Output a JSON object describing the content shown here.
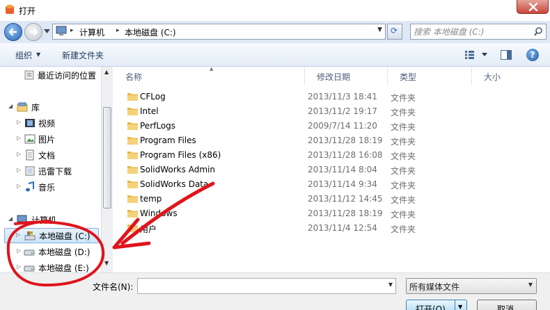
{
  "window": {
    "title": "打开",
    "close_icon": "close-icon"
  },
  "navbar": {
    "breadcrumbs": [
      "计算机",
      "本地磁盘 (C:)"
    ],
    "search_placeholder": "搜索 本地磁盘 (C:)"
  },
  "toolbar": {
    "organize_label": "组织",
    "new_folder_label": "新建文件夹",
    "help_label": "?"
  },
  "navpane": {
    "items": [
      {
        "label": "最近访问的位置",
        "icon": "recent-places-icon"
      },
      {
        "label": "库",
        "icon": "library-icon"
      },
      {
        "label": "视频",
        "icon": "video-icon"
      },
      {
        "label": "图片",
        "icon": "pictures-icon"
      },
      {
        "label": "文档",
        "icon": "documents-icon"
      },
      {
        "label": "迅雷下载",
        "icon": "download-folder-icon"
      },
      {
        "label": "音乐",
        "icon": "music-icon"
      },
      {
        "label": "计算机",
        "icon": "computer-icon"
      },
      {
        "label": "本地磁盘 (C:)",
        "icon": "system-drive-icon"
      },
      {
        "label": "本地磁盘 (D:)",
        "icon": "drive-icon"
      },
      {
        "label": "本地磁盘 (E:)",
        "icon": "drive-icon"
      }
    ]
  },
  "filelist": {
    "columns": [
      "名称",
      "修改日期",
      "类型",
      "大小"
    ],
    "rows": [
      {
        "name": "CFLog",
        "date": "2013/11/3 18:41",
        "type": "文件夹"
      },
      {
        "name": "Intel",
        "date": "2013/11/2 19:17",
        "type": "文件夹"
      },
      {
        "name": "PerfLogs",
        "date": "2009/7/14 11:20",
        "type": "文件夹"
      },
      {
        "name": "Program Files",
        "date": "2013/11/28 18:19",
        "type": "文件夹"
      },
      {
        "name": "Program Files (x86)",
        "date": "2013/11/28 16:08",
        "type": "文件夹"
      },
      {
        "name": "SolidWorks Admin",
        "date": "2013/11/14 8:04",
        "type": "文件夹"
      },
      {
        "name": "SolidWorks Data",
        "date": "2013/11/14 9:34",
        "type": "文件夹"
      },
      {
        "name": "temp",
        "date": "2013/11/12 14:45",
        "type": "文件夹"
      },
      {
        "name": "Windows",
        "date": "2013/11/28 18:19",
        "type": "文件夹"
      },
      {
        "name": "用户",
        "date": "2013/11/4 12:54",
        "type": "文件夹"
      }
    ]
  },
  "bottom": {
    "filename_label": "文件名(N):",
    "filename_value": "",
    "filter_value": "所有媒体文件",
    "open_label": "打开(O)",
    "cancel_label": "取消"
  },
  "colors": {
    "accent": "#2a68b8",
    "annotation": "#e0141b",
    "folder": "#f2c94c"
  }
}
